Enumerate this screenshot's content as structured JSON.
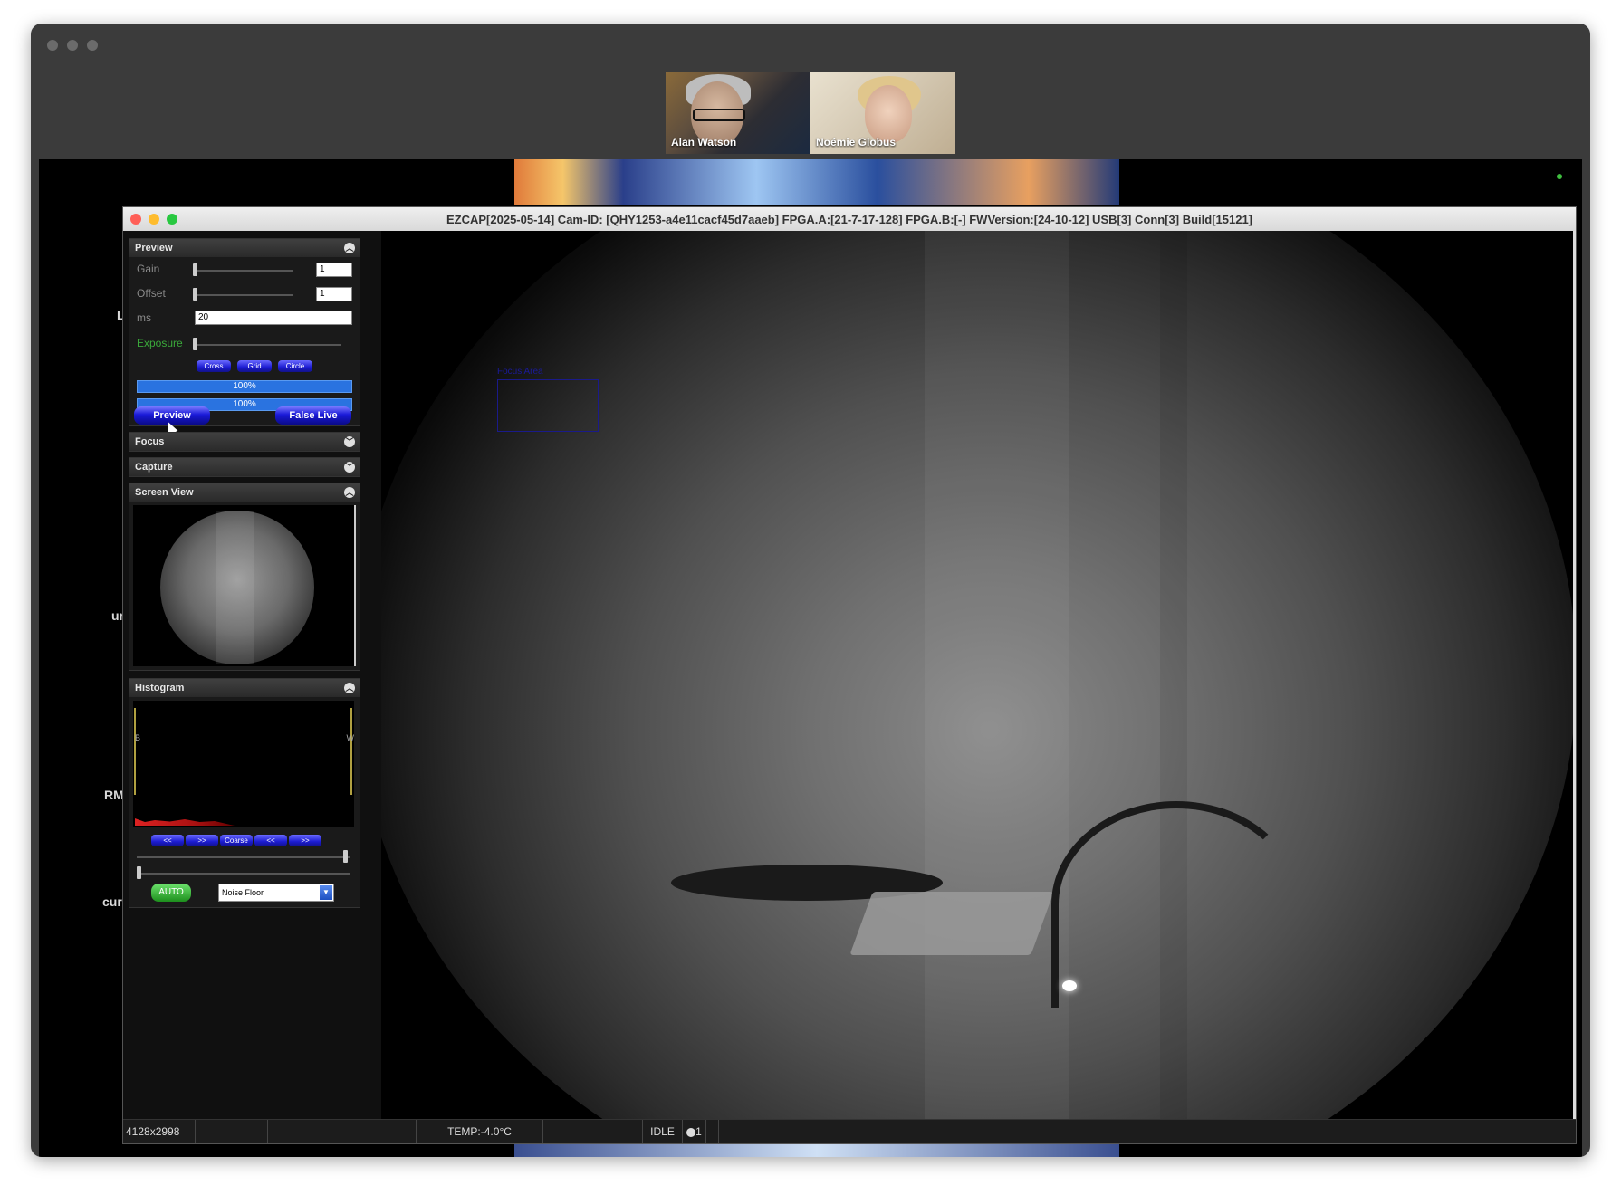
{
  "meeting": {
    "participants": [
      {
        "name": "Alan Watson"
      },
      {
        "name": "Noémie Globus"
      }
    ]
  },
  "background_text": {
    "items": [
      "L",
      "ur",
      "RM",
      "curi"
    ]
  },
  "app": {
    "title": "EZCAP[2025-05-14] Cam-ID: [QHY1253-a4e11cacf45d7aaeb]   FPGA.A:[21-7-17-128]  FPGA.B:[-]  FWVersion:[24-10-12] USB[3] Conn[3] Build[15121]",
    "colors": {
      "close": "#ff5f57",
      "minimize": "#febc2e",
      "maximize": "#28c840"
    }
  },
  "panel": {
    "preview": {
      "title": "Preview",
      "gain_label": "Gain",
      "gain_value": "1",
      "offset_label": "Offset",
      "offset_value": "1",
      "ms_label": "ms",
      "ms_value": "20",
      "exposure_label": "Exposure",
      "cross_label": "Cross",
      "grid_label": "Grid",
      "circle_label": "Circle",
      "progress1": "100%",
      "progress2": "100%",
      "preview_button": "Preview",
      "false_live_button": "False Live"
    },
    "focus": {
      "title": "Focus"
    },
    "capture": {
      "title": "Capture"
    },
    "screen_view": {
      "title": "Screen View"
    },
    "histogram": {
      "title": "Histogram",
      "b_label": "B",
      "w_label": "W",
      "btn_left1": "<<",
      "btn_right1": ">>",
      "btn_coarse": "Coarse",
      "btn_left2": "<<",
      "btn_right2": ">>",
      "auto_button": "AUTO",
      "mode_select": "Noise Floor"
    }
  },
  "viewer": {
    "focus_area_label": "Focus Area"
  },
  "status_bar": {
    "resolution": "4128x2998",
    "temp": "TEMP:-4.0°C",
    "state": "IDLE",
    "counter": "1"
  }
}
